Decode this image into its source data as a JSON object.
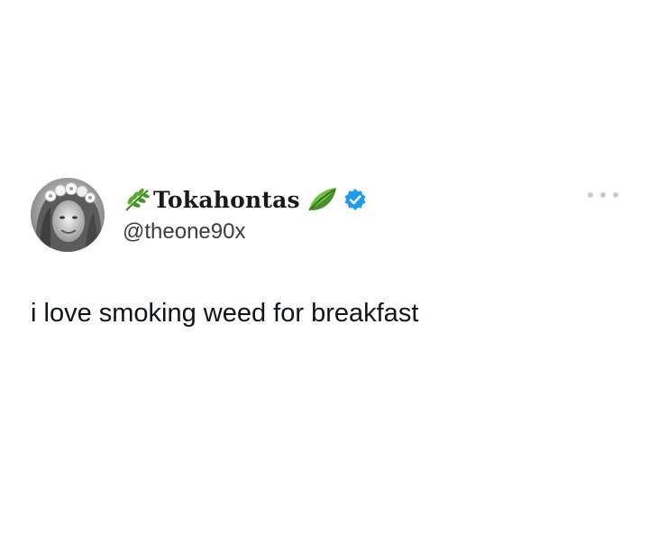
{
  "tweet": {
    "author": {
      "display_name": "Tokahontas",
      "handle": "@theone90x",
      "verified": true,
      "name_prefix_icon": "herb-icon",
      "name_suffix_icon": "leaf-icon"
    },
    "text": "i love smoking weed for breakfast",
    "more_icon": "more-options-icon"
  },
  "colors": {
    "background": "#ffffff",
    "text": "#0f1419",
    "handle": "#3c3c3c",
    "verified_badge": "#1d9bf0",
    "leaf_green": "#4a8f2a"
  }
}
